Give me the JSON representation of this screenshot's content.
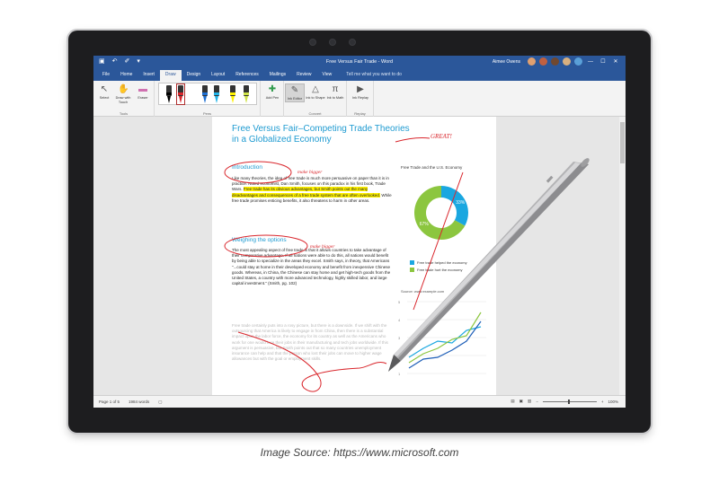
{
  "window": {
    "doc_title": "Free Versus Fair Trade - Word",
    "user_name": "Aimee Owens",
    "quick_access": [
      "▣",
      "↶",
      "✐",
      "▾"
    ],
    "window_controls": [
      "—",
      "☐",
      "✕"
    ]
  },
  "tabs": [
    {
      "label": "File",
      "active": false
    },
    {
      "label": "Home",
      "active": false
    },
    {
      "label": "Insert",
      "active": false
    },
    {
      "label": "Draw",
      "active": true
    },
    {
      "label": "Design",
      "active": false
    },
    {
      "label": "Layout",
      "active": false
    },
    {
      "label": "References",
      "active": false
    },
    {
      "label": "Mailings",
      "active": false
    },
    {
      "label": "Review",
      "active": false
    },
    {
      "label": "View",
      "active": false
    }
  ],
  "tell_me": "Tell me what you want to do",
  "ribbon": {
    "tools_group_label": "Tools",
    "pens_group_label": "Pens",
    "convert_group_label": "Convert",
    "replay_group_label": "Replay",
    "select": "Select",
    "draw_with_touch": "Draw with Touch",
    "eraser": "Eraser",
    "add_pen": "Add Pen",
    "ink_editor": "Ink Editor",
    "ink_to_shape": "Ink to Shape",
    "ink_to_math": "Ink to Math",
    "ink_replay": "Ink Replay"
  },
  "document": {
    "title": "Free Versus Fair–Competing Trade Theories in a Globalized Economy",
    "ink_great": "GREAT!",
    "ink_make_bigger_1": "make bigger",
    "ink_make_bigger_2": "make bigger",
    "intro_heading": "Introduction",
    "intro_text_a": "Like many theories, the idea of free trade is much more persuasive on paper than it is in practice. Noted economist, Dan Smith, focuses on this paradox in his first book, Trade Wars. ",
    "intro_text_highlight": "Free trade has its obvious advantages, but Smith points out the many disadvantages and consequences of a free trade system that are often overlooked.",
    "intro_text_b": " While free trade promises enticing benefits, it also threatens to harm in other areas.",
    "weighing_heading": "Weighing the options",
    "weighing_text": "The most appealing aspect of free trade is that it allows countries to take advantage of their comparative advantage. If all nations were able to do this, all nations would benefit by being able to specialize in the areas they excel. Smith says, in theory, that Americans \"...could stay at home in their developed economy and benefit from inexpensive Chinese goods. Whereas, in China, the Chinese can stay home and get high-tech goods from the United States, a country with more advanced technology, highly skilled labor, and large capital investment.\" (Smith, pg. 102)",
    "faded_text": "Free trade certainly puts into a rosy picture, but there is a downside. If we shift with the outsourcing that America is likely to engage in from China, then there is a substantial impact upon the labor force, the economy for its country as well as the Americans who work for one would lose their jobs in their manufacturing and tech jobs worldwide. If this argument is persuasive, but Smith points out that so many countries unemployment insurance can help and that the person who lost their jobs can move to higher wage allowances but with the goal or employment skills.",
    "chart_title": "Free Trade and the U.S. Economy",
    "legend_1": "Free trade helped the economy",
    "legend_2": "Free trade hurt the economy",
    "line_caption": "Source: www.example.com",
    "donut_label_1": "33%",
    "donut_label_2": "67%",
    "line_axis_labels": [
      "5",
      "4",
      "3",
      "2",
      "1"
    ]
  },
  "status": {
    "page": "Page 1 of 5",
    "words": "1984 words",
    "zoom": "100%"
  },
  "chart_data": {
    "type": "pie",
    "title": "Free Trade and the U.S. Economy",
    "categories": [
      "Free trade helped the economy",
      "Free trade hurt the economy"
    ],
    "values": [
      33,
      67
    ],
    "colors": [
      "#1aa7e0",
      "#8cc63f"
    ],
    "legend": "bottom"
  },
  "colors": {
    "word_blue": "#2b579a",
    "heading_blue": "#1f9bd1",
    "ink_red": "#d9262c",
    "highlight": "#fff200"
  },
  "caption": "Image Source: https://www.microsoft.com"
}
